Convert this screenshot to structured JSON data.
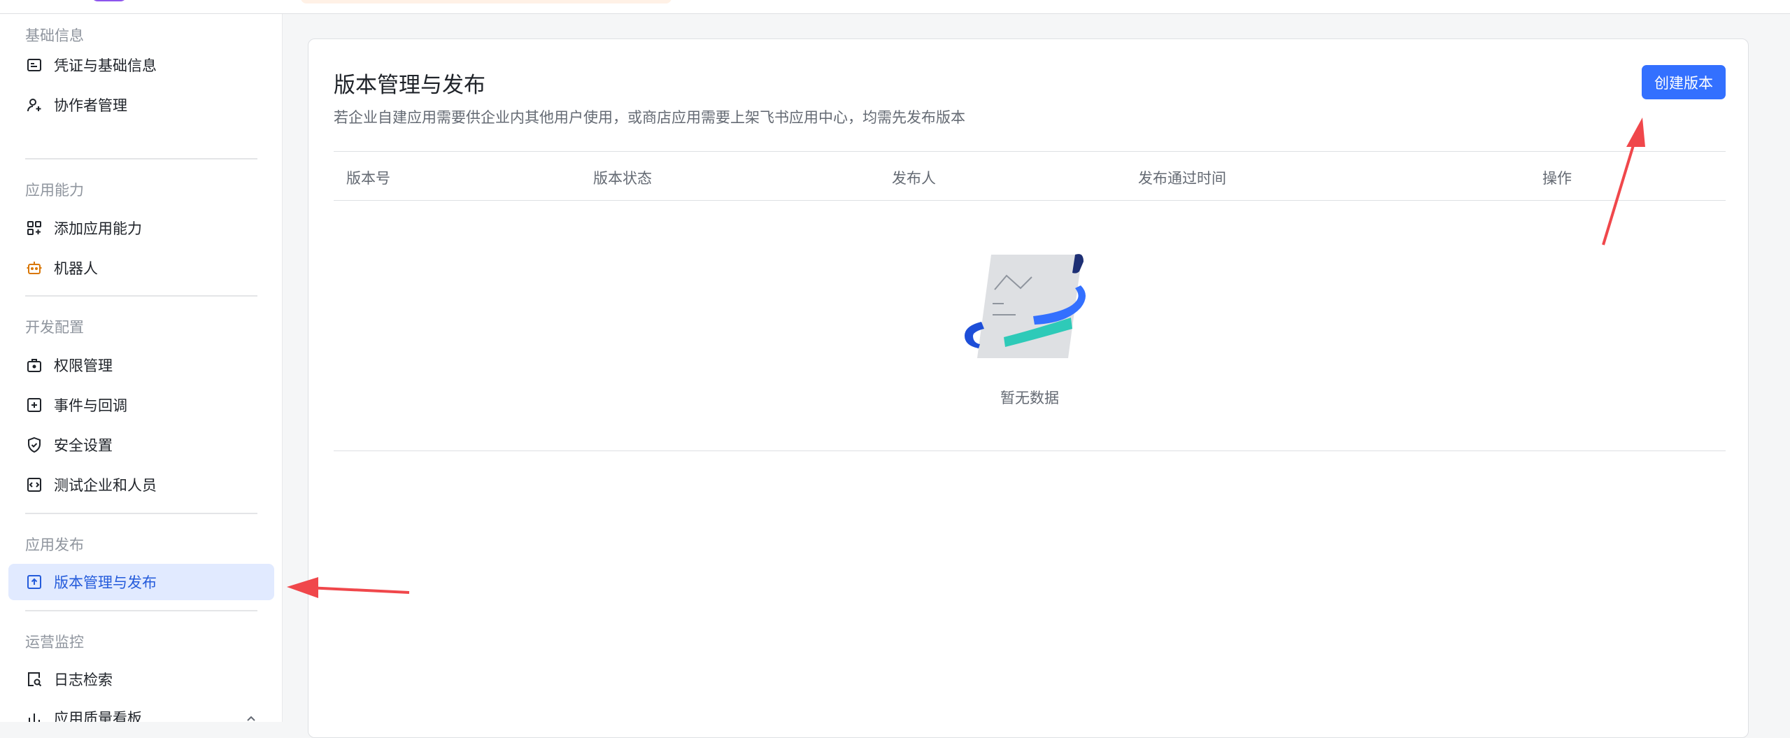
{
  "sidebar": {
    "groups": [
      {
        "title": "基础信息",
        "items": [
          {
            "label": "凭证与基础信息",
            "icon": "credential-card-icon"
          },
          {
            "label": "协作者管理",
            "icon": "add-user-icon"
          }
        ]
      },
      {
        "title": "应用能力",
        "items": [
          {
            "label": "添加应用能力",
            "icon": "apps-add-icon"
          },
          {
            "label": "机器人",
            "icon": "robot-icon"
          }
        ]
      },
      {
        "title": "开发配置",
        "items": [
          {
            "label": "权限管理",
            "icon": "permission-bag-icon"
          },
          {
            "label": "事件与回调",
            "icon": "event-plus-icon"
          },
          {
            "label": "安全设置",
            "icon": "shield-icon"
          },
          {
            "label": "测试企业和人员",
            "icon": "code-box-icon"
          }
        ]
      },
      {
        "title": "应用发布",
        "items": [
          {
            "label": "版本管理与发布",
            "icon": "upload-box-icon",
            "active": true
          }
        ]
      },
      {
        "title": "运营监控",
        "items": [
          {
            "label": "日志检索",
            "icon": "log-search-icon"
          },
          {
            "label": "应用质量看板",
            "icon": "dashboard-icon"
          }
        ]
      }
    ]
  },
  "main": {
    "title": "版本管理与发布",
    "description": "若企业自建应用需要供企业内其他用户使用，或商店应用需要上架飞书应用中心，均需先发布版本",
    "create_button": "创建版本",
    "table": {
      "columns": [
        "版本号",
        "版本状态",
        "发布人",
        "发布通过时间",
        "操作"
      ],
      "rows": [],
      "empty_text": "暂无数据"
    }
  },
  "colors": {
    "primary": "#3370ff",
    "active_bg": "#e1eaff",
    "active_text": "#245bdb",
    "annotation_arrow": "#f0474b"
  }
}
